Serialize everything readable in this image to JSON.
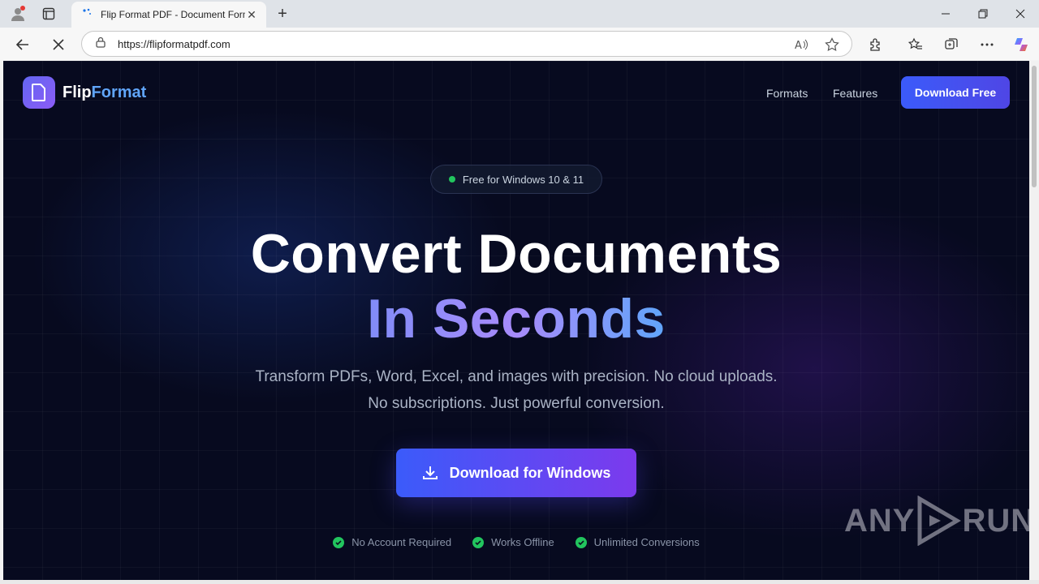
{
  "browser": {
    "tab_title": "Flip Format PDF - Document Form",
    "url": "https://flipformatpdf.com"
  },
  "nav": {
    "logo_part1": "Flip",
    "logo_part2": "Format",
    "links": [
      "Formats",
      "Features"
    ],
    "cta": "Download Free"
  },
  "hero": {
    "badge": "Free for Windows 10 & 11",
    "title_line1": "Convert Documents",
    "title_line2": "In Seconds",
    "subtitle_line1": "Transform PDFs, Word, Excel, and images with precision. No cloud uploads.",
    "subtitle_line2": "No subscriptions. Just powerful conversion.",
    "cta": "Download for Windows",
    "features": [
      "No Account Required",
      "Works Offline",
      "Unlimited Conversions"
    ]
  },
  "watermark": {
    "text_left": "ANY",
    "text_right": "RUN"
  },
  "colors": {
    "accent": "#4f46e5",
    "success": "#22c55e",
    "page_bg": "#070a1f"
  }
}
